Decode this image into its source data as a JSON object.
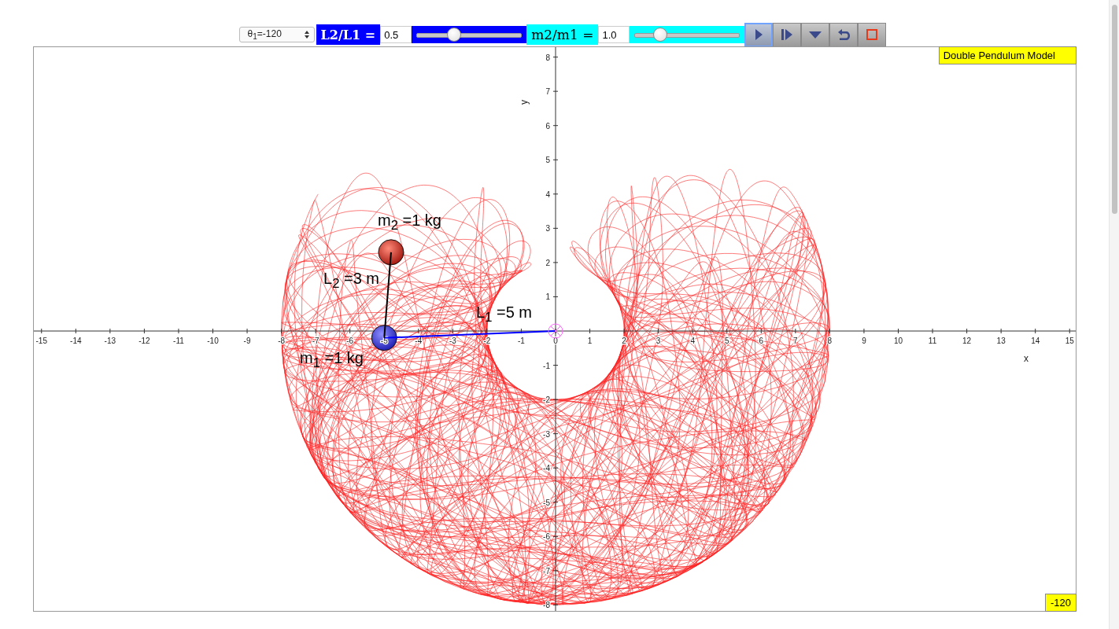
{
  "toolbar": {
    "angle_select": {
      "value": "θ$_{1}$=-120"
    },
    "length_ratio": {
      "label": "L2/L1 =",
      "value": "0.5",
      "level": 0.36
    },
    "mass_ratio": {
      "label": "m2/m1 =",
      "value": "1.0",
      "level": 0.24
    },
    "buttons": [
      {
        "kind": "play",
        "selected": true
      },
      {
        "kind": "step",
        "selected": false
      },
      {
        "kind": "menu",
        "selected": false
      },
      {
        "kind": "reset",
        "selected": false
      },
      {
        "kind": "stop",
        "selected": false
      }
    ]
  },
  "plot": {
    "title": "Double Pendulum Model",
    "readout": "-120",
    "x_axis": {
      "label": "x",
      "ticks": [
        "-15",
        "-14",
        "-13",
        "-12",
        "-11",
        "-10",
        "-9",
        "-8",
        "-7",
        "-6",
        "-5",
        "-4",
        "-3",
        "-2",
        "-1",
        "0",
        "1",
        "2",
        "3",
        "4",
        "5",
        "6",
        "7",
        "8",
        "9",
        "10",
        "11",
        "12",
        "13",
        "14",
        "15"
      ]
    },
    "y_axis": {
      "label": "y",
      "ticks": [
        "8",
        "7",
        "6",
        "5",
        "4",
        "3",
        "2",
        "1",
        "-1",
        "-2",
        "-3",
        "-4",
        "-5",
        "-6",
        "-7",
        "-8"
      ]
    },
    "labels": [
      {
        "text": "m$_{2}$ =1 kg"
      },
      {
        "text": "L$_{2}$ =3 m"
      },
      {
        "text": "L$_{1}$ =5 m"
      },
      {
        "text": "m$_{1}$ =1 kg"
      }
    ]
  }
}
